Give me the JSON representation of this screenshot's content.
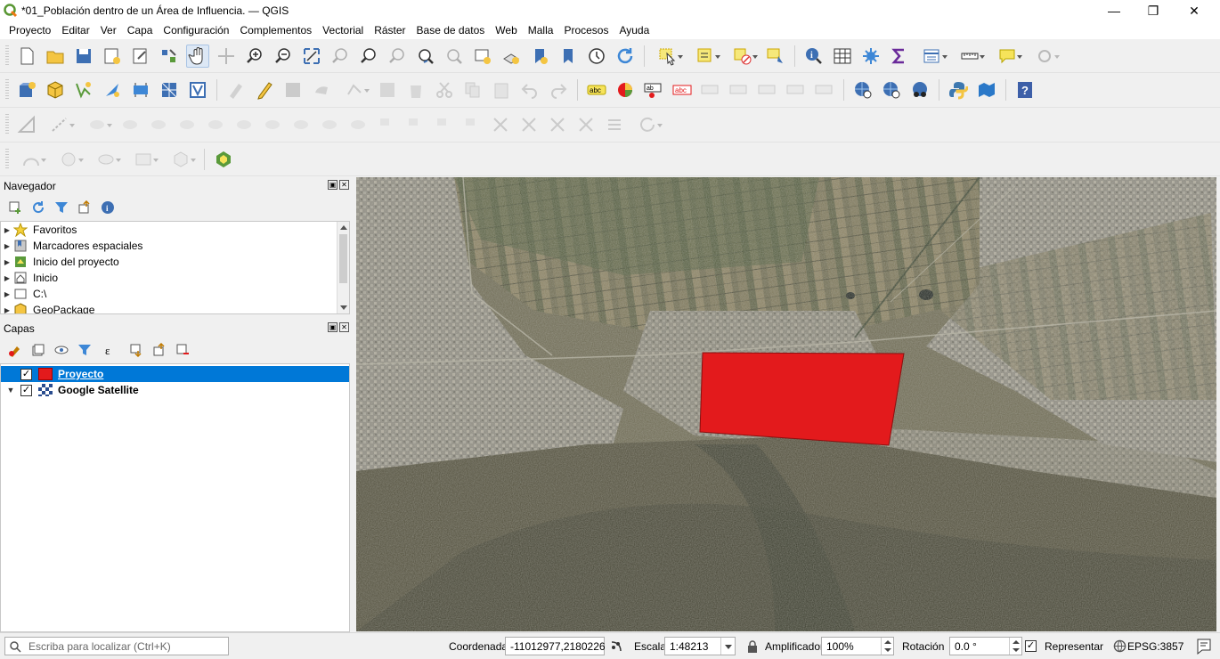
{
  "window": {
    "title": "*01_Población dentro de un Área de Influencia. — QGIS",
    "minimize": "—",
    "maximize": "❐",
    "close": "✕"
  },
  "menu": [
    "Proyecto",
    "Editar",
    "Ver",
    "Capa",
    "Configuración",
    "Complementos",
    "Vectorial",
    "Ráster",
    "Base de datos",
    "Web",
    "Malla",
    "Procesos",
    "Ayuda"
  ],
  "browser_panel": {
    "title": "Navegador",
    "items": [
      {
        "label": "Favoritos",
        "icon": "star-icon"
      },
      {
        "label": "Marcadores espaciales",
        "icon": "bookmark-icon"
      },
      {
        "label": "Inicio del proyecto",
        "icon": "project-home-icon"
      },
      {
        "label": "Inicio",
        "icon": "home-icon"
      },
      {
        "label": "C:\\",
        "icon": "drive-icon"
      },
      {
        "label": "GeoPackage",
        "icon": "geopackage-icon"
      }
    ]
  },
  "layers_panel": {
    "title": "Capas",
    "layers": [
      {
        "name": "Proyecto",
        "checked": true,
        "selected": true,
        "color": "#e31a1c"
      },
      {
        "name": "Google Satellite",
        "checked": true,
        "selected": false
      }
    ]
  },
  "statusbar": {
    "locator_placeholder": "Escriba para localizar (Ctrl+K)",
    "coord_label": "Coordenada",
    "coord_value": "-11012977,2180226",
    "scale_label": "Escala",
    "scale_value": "1:48213",
    "magnifier_label": "Amplificador",
    "magnifier_value": "100%",
    "rotation_label": "Rotación",
    "rotation_value": "0.0 °",
    "render_label": "Representar",
    "crs": "EPSG:3857"
  },
  "colors": {
    "polygon_fill": "#e31a1c",
    "selection": "#0078d7"
  }
}
